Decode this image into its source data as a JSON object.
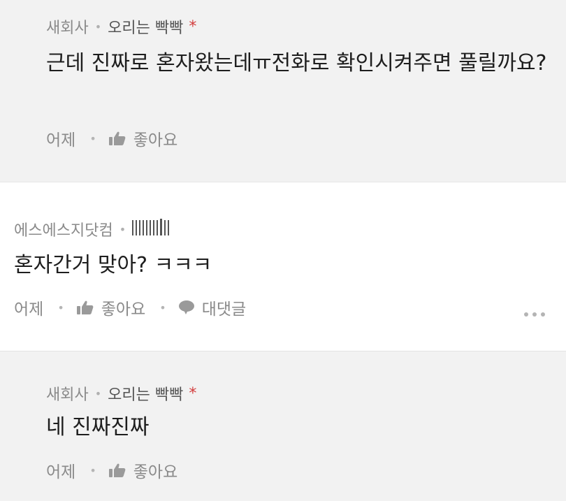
{
  "reply1": {
    "author": "새회사",
    "title": "오리는 빡빡",
    "badge": "*",
    "body": "근데 진짜로 혼자왔는데ㅠ전화로 확인시켜주면 풀릴까요?",
    "time": "어제",
    "like_label": "좋아요"
  },
  "top": {
    "author": "에스에스지닷컴",
    "title": "IIIIIIII|II",
    "body": "혼자간거 맞아? ㅋㅋㅋ",
    "time": "어제",
    "like_label": "좋아요",
    "reply_label": "대댓글"
  },
  "reply2": {
    "author": "새회사",
    "title": "오리는 빡빡",
    "badge": "*",
    "body": "네 진짜진짜",
    "time": "어제",
    "like_label": "좋아요"
  },
  "icons": {
    "like": "thumbs-up-icon",
    "reply": "speech-bubble-icon",
    "more": "more-dots-icon"
  },
  "colors": {
    "reply_background": "#f2f2f2",
    "badge": "#d33d3d",
    "meta_text": "#8a8a8a"
  }
}
